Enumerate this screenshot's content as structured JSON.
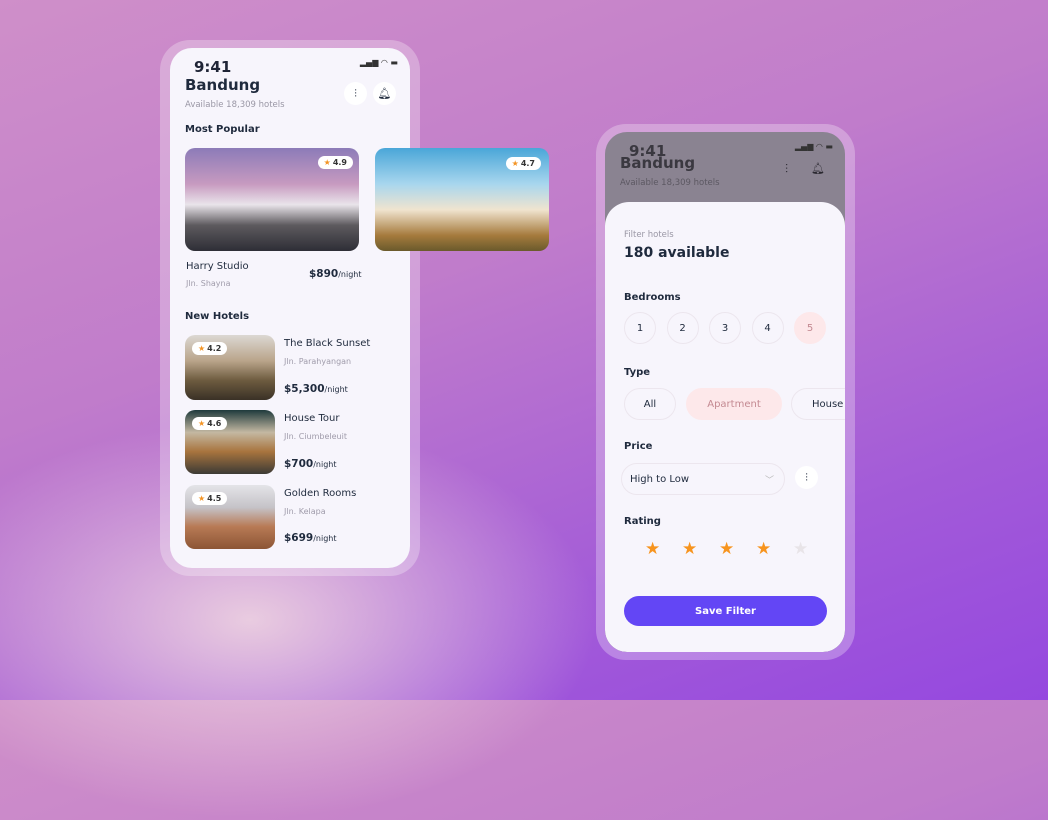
{
  "home": {
    "time": "9:41",
    "city": "Bandung",
    "available": "Available 18,309 hotels",
    "popular_heading": "Most Popular",
    "popular": [
      {
        "name": "Harry Studio",
        "address": "Jln. Shayna",
        "price": "$890",
        "unit": "/night",
        "rating": "4.9"
      },
      {
        "rating": "4.7"
      }
    ],
    "new_heading": "New Hotels",
    "new": [
      {
        "name": "The Black Sunset",
        "address": "Jln. Parahyangan",
        "price": "$5,300",
        "unit": "/night",
        "rating": "4.2"
      },
      {
        "name": "House Tour",
        "address": "Jln. Ciumbeleuit",
        "price": "$700",
        "unit": "/night",
        "rating": "4.6"
      },
      {
        "name": "Golden Rooms",
        "address": "Jln. Kelapa",
        "price": "$699",
        "unit": "/night",
        "rating": "4.5"
      }
    ]
  },
  "filter": {
    "time": "9:41",
    "city": "Bandung",
    "available": "Available 18,309 hotels",
    "label": "Filter hotels",
    "count": "180 available",
    "bedrooms_label": "Bedrooms",
    "bedrooms": [
      "1",
      "2",
      "3",
      "4",
      "5"
    ],
    "bedrooms_selected": "5",
    "type_label": "Type",
    "types": [
      "All",
      "Apartment",
      "House"
    ],
    "type_selected": "Apartment",
    "price_label": "Price",
    "price_sort": "High to Low",
    "rating_label": "Rating",
    "rating": 4,
    "rating_max": 5,
    "save": "Save Filter"
  },
  "colors": {
    "accent": "#6346f5",
    "star": "#f7941e",
    "selected": "#fde8ea"
  }
}
